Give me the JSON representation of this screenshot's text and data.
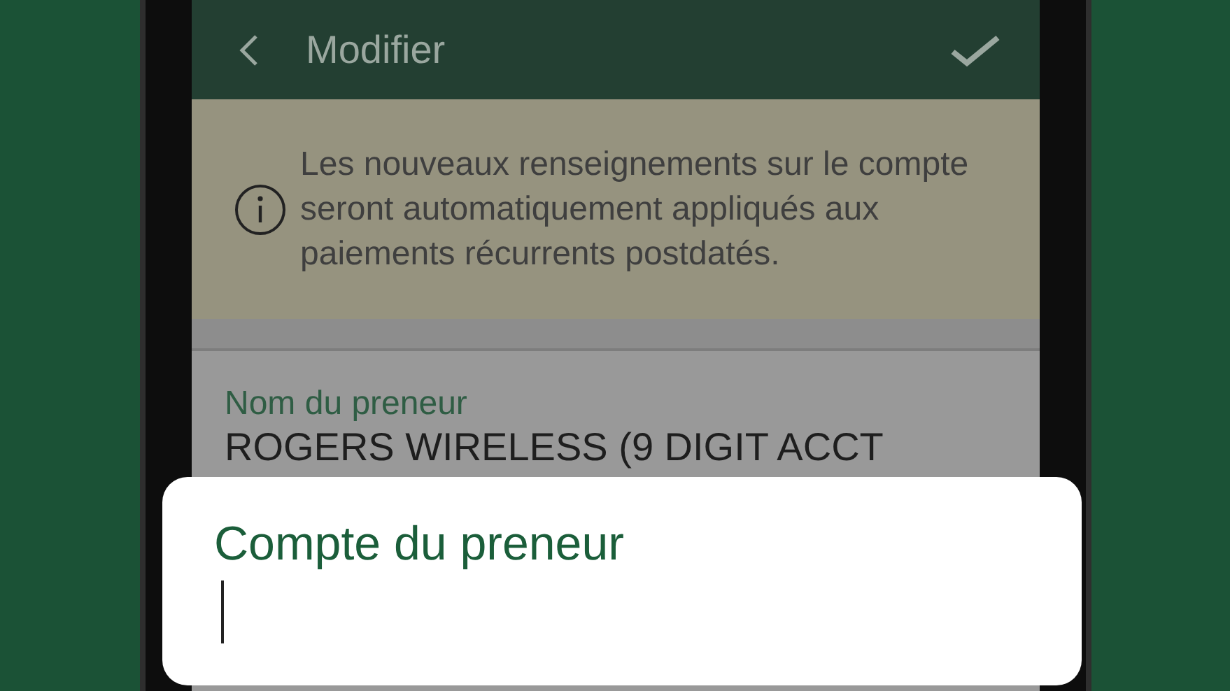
{
  "header": {
    "title": "Modifier"
  },
  "banner": {
    "text": "Les nouveaux renseignements sur le compte seront automatiquement appliqués aux paiements récurrents postdatés."
  },
  "fields": [
    {
      "label": "Nom du preneur",
      "value": "ROGERS WIRELESS (9 DIGIT ACCT"
    }
  ],
  "dialog": {
    "label": "Compte du preneur"
  }
}
